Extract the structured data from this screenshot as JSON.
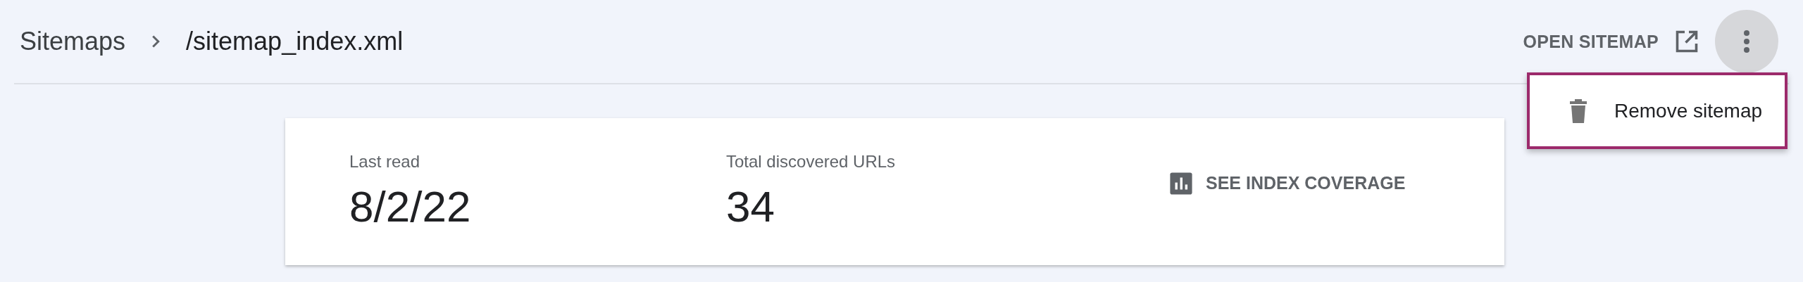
{
  "breadcrumb": [
    {
      "label": "Sitemaps"
    },
    {
      "label": "/sitemap_index.xml"
    }
  ],
  "header_actions": {
    "open_button": "OPEN SITEMAP"
  },
  "menu": {
    "items": [
      {
        "label": "Remove sitemap"
      }
    ]
  },
  "stats": [
    {
      "label": "Last read",
      "value": "8/2/22"
    },
    {
      "label": "Total discovered URLs",
      "value": "34"
    }
  ],
  "coverage_link": "SEE INDEX COVERAGE"
}
